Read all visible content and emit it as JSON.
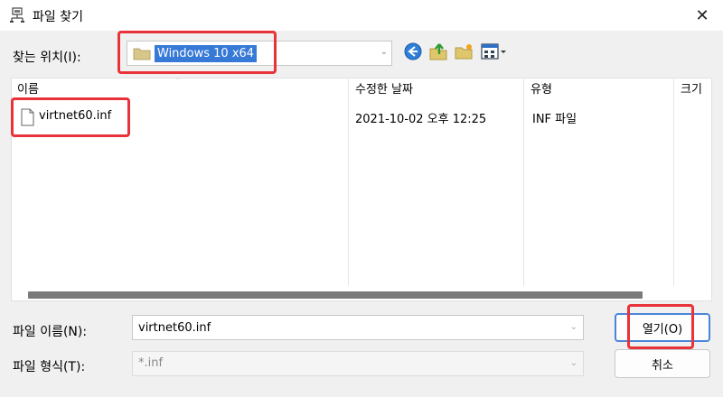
{
  "window": {
    "title": "파일 찾기"
  },
  "lookin": {
    "label": "찾는 위치(I):",
    "value": "Windows 10 x64"
  },
  "toolbar": {
    "back_icon": "back-arrow-icon",
    "up_icon": "up-folder-icon",
    "new_icon": "new-folder-icon",
    "view_icon": "view-menu-icon"
  },
  "filelist": {
    "columns": [
      "이름",
      "수정한 날짜",
      "유형",
      "크기"
    ],
    "rows": [
      {
        "name": "virtnet60.inf",
        "modified": "2021-10-02 오후 12:25",
        "type": "INF 파일",
        "size": ""
      }
    ]
  },
  "filename": {
    "label": "파일 이름(N):",
    "value": "virtnet60.inf"
  },
  "filetype": {
    "label": "파일 형식(T):",
    "value": "*.inf"
  },
  "buttons": {
    "open": "열기(O)",
    "cancel": "취소"
  },
  "colors": {
    "highlight": "#3779d6",
    "annotation_red": "#e8333a"
  }
}
